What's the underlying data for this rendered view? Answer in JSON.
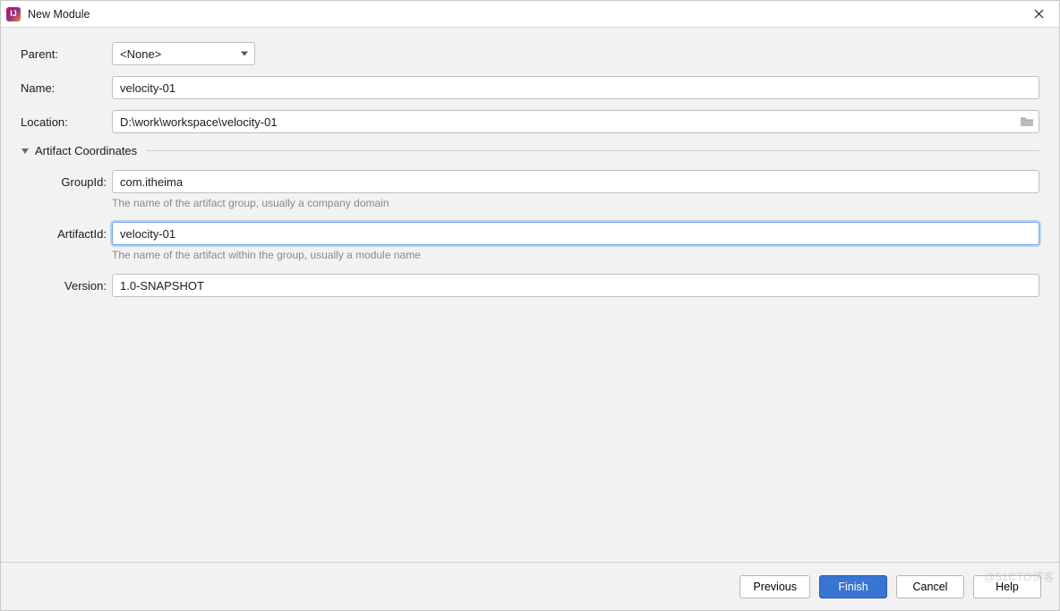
{
  "window": {
    "title": "New Module",
    "icon_text": "IJ"
  },
  "form": {
    "parent": {
      "label": "Parent:",
      "value": "<None>"
    },
    "name": {
      "label": "Name:",
      "value": "velocity-01"
    },
    "location": {
      "label": "Location:",
      "value": "D:\\work\\workspace\\velocity-01"
    }
  },
  "section": {
    "title": "Artifact Coordinates",
    "groupId": {
      "label": "GroupId:",
      "value": "com.itheima",
      "hint": "The name of the artifact group, usually a company domain"
    },
    "artifactId": {
      "label": "ArtifactId:",
      "value": "velocity-01",
      "hint": "The name of the artifact within the group, usually a module name"
    },
    "version": {
      "label": "Version:",
      "value": "1.0-SNAPSHOT"
    }
  },
  "footer": {
    "previous": "Previous",
    "finish": "Finish",
    "cancel": "Cancel",
    "help": "Help"
  },
  "watermark": "@51CTO博客"
}
